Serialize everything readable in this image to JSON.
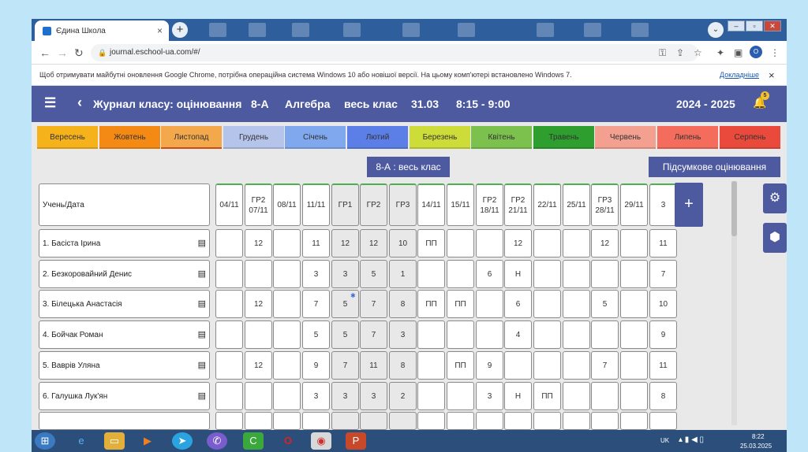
{
  "browser": {
    "tab_title": "Єдина Школа",
    "tab_close": "×",
    "new_tab": "+",
    "profile_dropdown": "⌄",
    "url": "journal.eschool-ua.com/#/",
    "profile_initial": "O",
    "info_message": "Щоб отримувати майбутні оновлення Google Chrome, потрібна операційна система Windows 10 або новішої версії. На цьому комп'ютері встановлено Windows 7.",
    "info_link": "Докладніше",
    "info_close": "×"
  },
  "header": {
    "title": "Журнал класу: оцінювання",
    "class": "8-А",
    "subject": "Алгебра",
    "group": "весь клас",
    "date": "31.03",
    "time": "8:15 - 9:00",
    "year": "2024 - 2025",
    "notif_count": "5"
  },
  "months": [
    {
      "label": "Вересень",
      "color": "#f6b21b"
    },
    {
      "label": "Жовтень",
      "color": "#f48a14"
    },
    {
      "label": "Листопад",
      "color": "#f4a84c"
    },
    {
      "label": "Грудень",
      "color": "#b4c4ea"
    },
    {
      "label": "Січень",
      "color": "#7fa8ee"
    },
    {
      "label": "Лютий",
      "color": "#5b7fe6"
    },
    {
      "label": "Березень",
      "color": "#cddc39"
    },
    {
      "label": "Квітень",
      "color": "#7cc14e"
    },
    {
      "label": "Травень",
      "color": "#2e9e2e"
    },
    {
      "label": "Червень",
      "color": "#f4a090"
    },
    {
      "label": "Липень",
      "color": "#f36c5c"
    },
    {
      "label": "Серпень",
      "color": "#ea4a3c"
    }
  ],
  "active_month": "Листопад",
  "class_button": "8-А : весь клас",
  "summary_button": "Підсумкове оцінювання",
  "table": {
    "student_header": "Учень/Дата",
    "columns": [
      "04/11",
      "ГР2\n07/11",
      "08/11",
      "11/11",
      "ГР1",
      "ГР2",
      "ГР3",
      "14/11",
      "15/11",
      "ГР2\n18/11",
      "ГР2\n21/11",
      "22/11",
      "25/11",
      "ГР3\n28/11",
      "29/11",
      "3"
    ],
    "rows": [
      {
        "name": "1. Басіста Ірина",
        "marks": [
          "",
          "12",
          "",
          "11",
          "12",
          "12",
          "10",
          "ПП",
          "",
          "",
          "12",
          "",
          "",
          "12",
          "",
          "11"
        ]
      },
      {
        "name": "2. Безкоровайний Денис",
        "marks": [
          "",
          "",
          "",
          "3",
          "3",
          "5",
          "1",
          "",
          "",
          "6",
          "Н",
          "",
          "",
          "",
          "",
          "7"
        ]
      },
      {
        "name": "3. Білецька Анастасія",
        "marks": [
          "",
          "12",
          "",
          "7",
          "5",
          "7",
          "8",
          "ПП",
          "ПП",
          "",
          "6",
          "",
          "",
          "5",
          "",
          "10"
        ]
      },
      {
        "name": "4. Бойчак Роман",
        "marks": [
          "",
          "",
          "",
          "5",
          "5",
          "7",
          "3",
          "",
          "",
          "",
          "4",
          "",
          "",
          "",
          "",
          "9"
        ]
      },
      {
        "name": "5. Ваврів Уляна",
        "marks": [
          "",
          "12",
          "",
          "9",
          "7",
          "11",
          "8",
          "",
          "ПП",
          "9",
          "",
          "",
          "",
          "7",
          "",
          "11"
        ]
      },
      {
        "name": "6. Галушка Лук'ян",
        "marks": [
          "",
          "",
          "",
          "3",
          "3",
          "3",
          "2",
          "",
          "",
          "3",
          "Н",
          "ПП",
          "",
          "",
          "",
          "8"
        ]
      }
    ]
  },
  "add_column": "+",
  "side_buttons": {
    "settings": "⚙",
    "export": "⬢"
  },
  "taskbar": {
    "lang": "UK",
    "time": "8:22",
    "date": "25.03.2025"
  }
}
